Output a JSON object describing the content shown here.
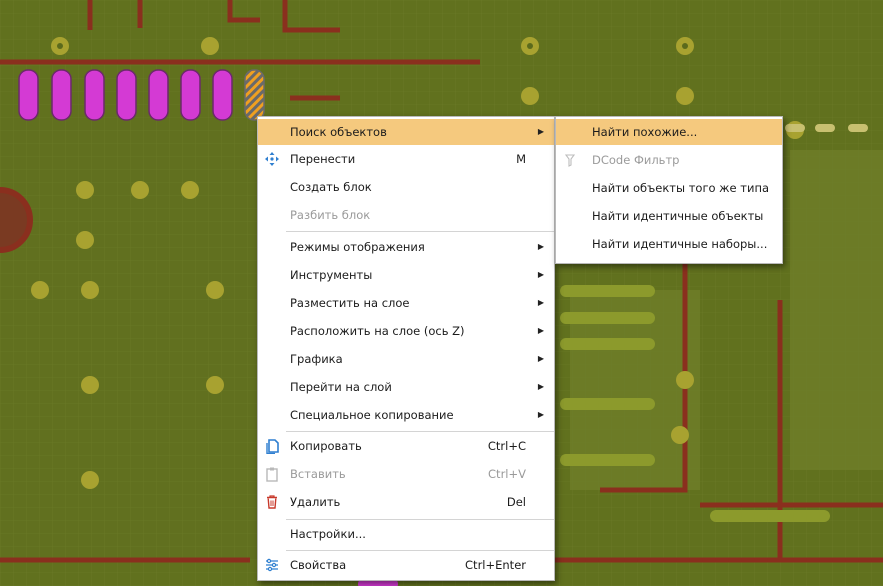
{
  "context_menu": {
    "items": [
      {
        "label": "Поиск объектов",
        "shortcut": "",
        "submenu": true,
        "highlighted": true,
        "disabled": false,
        "icon": ""
      },
      {
        "label": "Перенести",
        "shortcut": "M",
        "submenu": false,
        "disabled": false,
        "icon": "move-icon"
      },
      {
        "label": "Создать блок",
        "shortcut": "",
        "submenu": false,
        "disabled": false,
        "icon": ""
      },
      {
        "label": "Разбить блок",
        "shortcut": "",
        "submenu": false,
        "disabled": true,
        "icon": ""
      },
      {
        "label": "Режимы отображения",
        "shortcut": "",
        "submenu": true,
        "disabled": false,
        "icon": ""
      },
      {
        "label": "Инструменты",
        "shortcut": "",
        "submenu": true,
        "disabled": false,
        "icon": ""
      },
      {
        "label": "Разместить на слое",
        "shortcut": "",
        "submenu": true,
        "disabled": false,
        "icon": ""
      },
      {
        "label": "Расположить на слое (ось Z)",
        "shortcut": "",
        "submenu": true,
        "disabled": false,
        "icon": ""
      },
      {
        "label": "Графика",
        "shortcut": "",
        "submenu": true,
        "disabled": false,
        "icon": ""
      },
      {
        "label": "Перейти на слой",
        "shortcut": "",
        "submenu": true,
        "disabled": false,
        "icon": ""
      },
      {
        "label": "Специальное копирование",
        "shortcut": "",
        "submenu": true,
        "disabled": false,
        "icon": ""
      },
      {
        "label": "Копировать",
        "shortcut": "Ctrl+C",
        "submenu": false,
        "disabled": false,
        "icon": "copy-icon"
      },
      {
        "label": "Вставить",
        "shortcut": "Ctrl+V",
        "submenu": false,
        "disabled": true,
        "icon": "paste-icon"
      },
      {
        "label": "Удалить",
        "shortcut": "Del",
        "submenu": false,
        "disabled": false,
        "icon": "delete-icon"
      },
      {
        "label": "Настройки...",
        "shortcut": "",
        "submenu": false,
        "disabled": false,
        "icon": ""
      },
      {
        "label": "Свойства",
        "shortcut": "Ctrl+Enter",
        "submenu": false,
        "disabled": false,
        "icon": "properties-icon"
      }
    ]
  },
  "submenu": {
    "items": [
      {
        "label": "Найти похожие...",
        "highlighted": true,
        "disabled": false,
        "icon": ""
      },
      {
        "label": "DCode Фильтр",
        "highlighted": false,
        "disabled": true,
        "icon": "filter-icon"
      },
      {
        "label": "Найти объекты того же типа",
        "highlighted": false,
        "disabled": false,
        "icon": ""
      },
      {
        "label": "Найти идентичные объекты",
        "highlighted": false,
        "disabled": false,
        "icon": ""
      },
      {
        "label": "Найти идентичные наборы...",
        "highlighted": false,
        "disabled": false,
        "icon": ""
      }
    ]
  },
  "colors": {
    "board": "#5b6a1c",
    "trace": "#8a2f1e",
    "pad_magenta": "#d43ad4",
    "pad_selected": "#f0a020",
    "via": "#a8a230",
    "highlight": "#f5c97e"
  }
}
